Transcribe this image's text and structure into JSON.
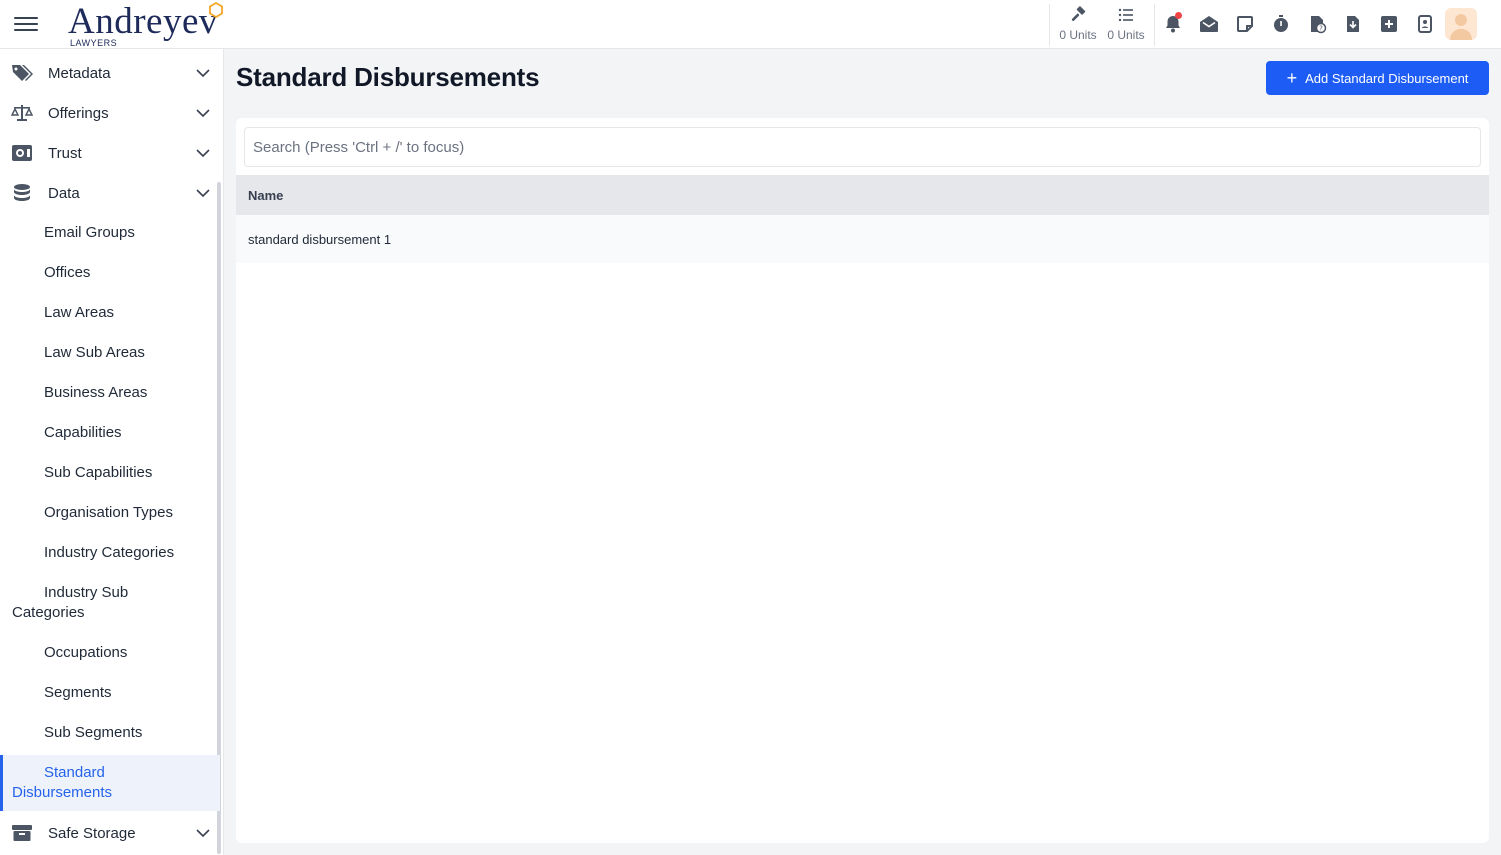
{
  "header": {
    "logo_name": "Andreyev",
    "logo_sub": "LAWYERS",
    "units": [
      {
        "icon": "gavel-icon",
        "label": "0 Units"
      },
      {
        "icon": "list-icon",
        "label": "0 Units"
      }
    ],
    "icons": [
      "bell-icon",
      "mail-open-icon",
      "note-icon",
      "stopwatch-icon",
      "file-question-icon",
      "file-download-icon",
      "plus-square-icon",
      "contact-card-icon"
    ],
    "notification_dot_color": "#ef4444"
  },
  "sidebar": {
    "sections": [
      {
        "icon": "tags-icon",
        "label": "Metadata"
      },
      {
        "icon": "scales-icon",
        "label": "Offerings"
      },
      {
        "icon": "trust-icon",
        "label": "Trust"
      },
      {
        "icon": "database-icon",
        "label": "Data"
      }
    ],
    "data_items": [
      "Email Groups",
      "Offices",
      "Law Areas",
      "Law Sub Areas",
      "Business Areas",
      "Capabilities",
      "Sub Capabilities",
      "Organisation Types",
      "Industry Categories",
      "Industry Sub Categories",
      "Occupations",
      "Segments",
      "Sub Segments",
      "Standard Disbursements"
    ],
    "active_item": "Standard Disbursements",
    "bottom_section": {
      "icon": "archive-icon",
      "label": "Safe Storage"
    }
  },
  "main": {
    "title": "Standard Disbursements",
    "add_button_label": "Add Standard Disbursement",
    "search_placeholder": "Search (Press 'Ctrl + /' to focus)",
    "table": {
      "columns": [
        "Name"
      ],
      "rows": [
        [
          "standard disbursement 1"
        ]
      ]
    }
  },
  "colors": {
    "accent": "#1d5cf5",
    "active_text": "#2563eb",
    "active_bg": "#eef2fb"
  }
}
